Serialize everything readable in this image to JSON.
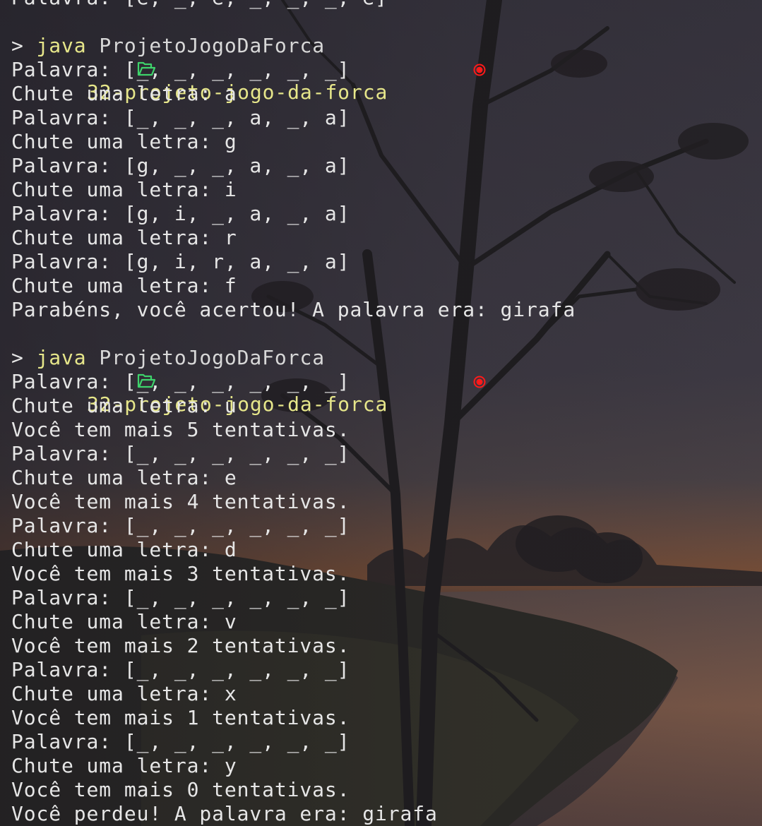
{
  "terminal": {
    "partial_top_line": "Palavra: [e, _, e, _, _, _, e]",
    "sessions": [
      {
        "dir": "32-projeto-jogo-da-forca",
        "caret": ">",
        "command": "java",
        "command_arg": "ProjetoJogoDaForca",
        "output": [
          "Palavra: [_, _, _, _, _, _]",
          "Chute uma letra: a",
          "Palavra: [_, _, _, a, _, a]",
          "Chute uma letra: g",
          "Palavra: [g, _, _, a, _, a]",
          "Chute uma letra: i",
          "Palavra: [g, i, _, a, _, a]",
          "Chute uma letra: r",
          "Palavra: [g, i, r, a, _, a]",
          "Chute uma letra: f",
          "Parabéns, você acertou! A palavra era: girafa"
        ]
      },
      {
        "dir": "32-projeto-jogo-da-forca",
        "caret": ">",
        "command": "java",
        "command_arg": "ProjetoJogoDaForca",
        "output": [
          "Palavra: [_, _, _, _, _, _]",
          "Chute uma letra: u",
          "Você tem mais 5 tentativas.",
          "Palavra: [_, _, _, _, _, _]",
          "Chute uma letra: e",
          "Você tem mais 4 tentativas.",
          "Palavra: [_, _, _, _, _, _]",
          "Chute uma letra: d",
          "Você tem mais 3 tentativas.",
          "Palavra: [_, _, _, _, _, _]",
          "Chute uma letra: v",
          "Você tem mais 2 tentativas.",
          "Palavra: [_, _, _, _, _, _]",
          "Chute uma letra: x",
          "Você tem mais 1 tentativas.",
          "Palavra: [_, _, _, _, _, _]",
          "Chute uma letra: y",
          "Você tem mais 0 tentativas.",
          "Você perdeu! A palavra era: girafa"
        ]
      }
    ]
  },
  "icons": {
    "folder": "folder-open-icon",
    "status": "record-dot-icon"
  },
  "colors": {
    "text": "#e6e6e6",
    "prompt": "#e6e68a",
    "folder": "#3ed36b",
    "status_dot": "#ff1a1a"
  }
}
